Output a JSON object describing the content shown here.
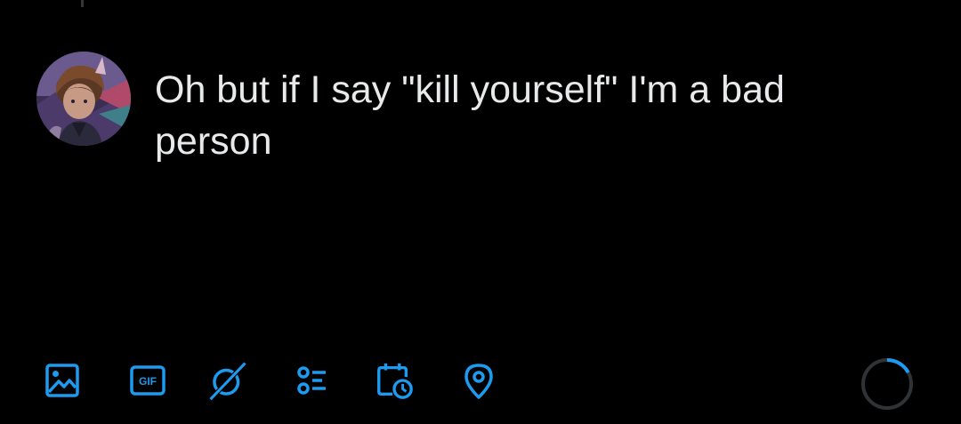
{
  "composer": {
    "text": "Oh but if I say \"kill yourself\" I'm a bad person"
  },
  "toolbar": {
    "items": [
      {
        "icon": "image-icon"
      },
      {
        "icon": "gif-icon",
        "label": "GIF"
      },
      {
        "icon": "grok-icon"
      },
      {
        "icon": "poll-icon"
      },
      {
        "icon": "schedule-icon"
      },
      {
        "icon": "location-icon"
      }
    ],
    "accent_color": "#1d9bf0"
  },
  "character_counter": {
    "progress": 0.17
  }
}
